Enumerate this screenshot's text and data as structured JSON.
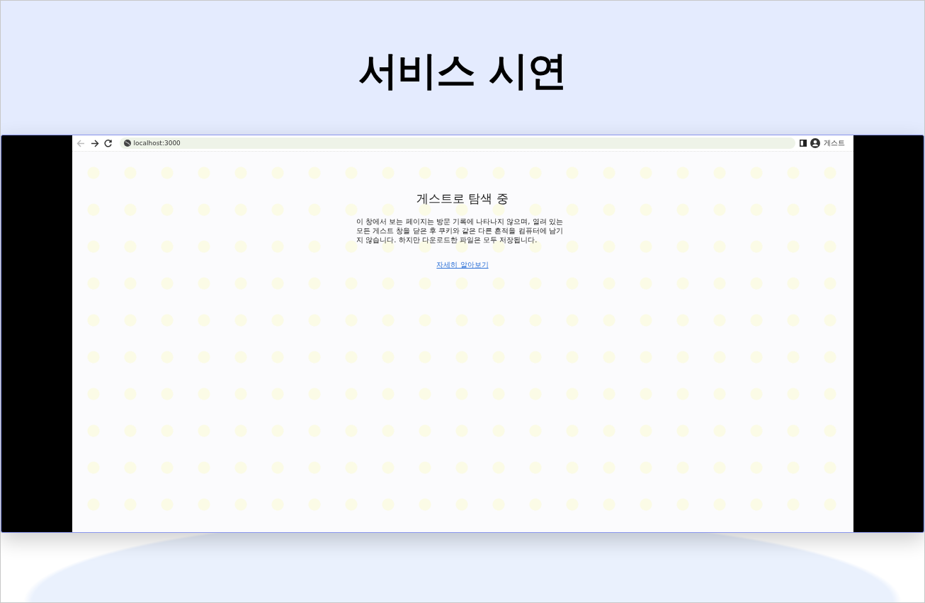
{
  "slide": {
    "title": "서비스 시연"
  },
  "browser": {
    "nav_buttons": [
      {
        "kind": "back",
        "disabled": true
      },
      {
        "kind": "forward",
        "disabled": false
      },
      {
        "kind": "reload",
        "disabled": false
      }
    ],
    "address": "localhost:3000",
    "profile_label": "게스트"
  },
  "page": {
    "heading": "게스트로 탐색 중",
    "description": "이 창에서 보는 페이지는 방문 기록에 나타나지 않으며, 열려 있는 모든 게스트 창을 닫은 후 쿠키와 같은 다른 흔적을 컴퓨터에 남기지 않습니다. 하지만 다운로드한 파일은 모두 저장됩니다.",
    "link": "자세히 알아보기"
  }
}
